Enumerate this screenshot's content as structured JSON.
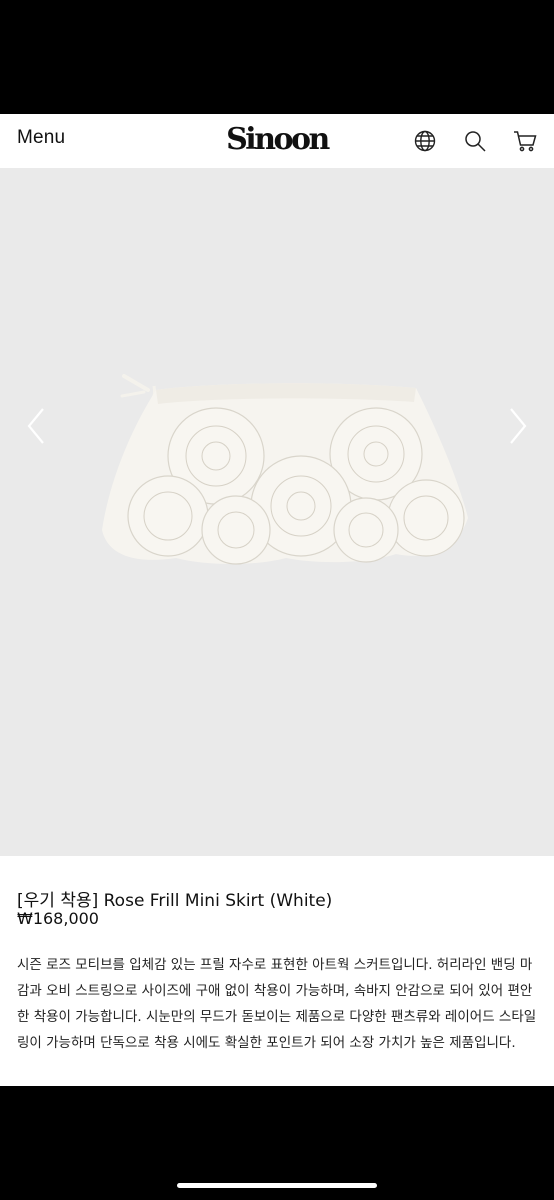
{
  "header": {
    "menu_label": "Menu",
    "logo_text": "Sinoon",
    "icons": [
      "globe-icon",
      "search-icon",
      "cart-icon"
    ]
  },
  "gallery": {
    "image_alt": "Rose Frill Mini Skirt (White)",
    "prev_icon": "chevron-left-icon",
    "next_icon": "chevron-right-icon",
    "background": "#eaeaea"
  },
  "product": {
    "title": "[우기 착용] Rose Frill Mini Skirt (White)",
    "price": "₩168,000",
    "description": "시즌 로즈 모티브를 입체감 있는 프릴 자수로 표현한 아트웍 스커트입니다. 허리라인 밴딩 마감과 오비 스트링으로 사이즈에 구애 없이 착용이 가능하며, 속바지 안감으로 되어 있어 편안한 착용이 가능합니다. 시눈만의 무드가 돋보이는 제품으로 다양한 팬츠류와 레이어드 스타일링이 가능하며 단독으로 착용 시에도 확실한 포인트가 되어 소장 가치가 높은 제품입니다."
  }
}
